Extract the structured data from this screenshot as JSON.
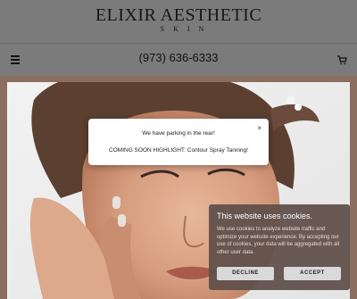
{
  "header": {
    "logo_main": "ELIXIR AESTHETIC",
    "logo_sub": "SKIN"
  },
  "navbar": {
    "phone": "(973) 636-6333"
  },
  "modal": {
    "close": "×",
    "line1": "We have parking in the rear!",
    "line2": "COMING SOON HIGHLIGHT: Contour Spray Tanning!"
  },
  "cookie": {
    "title": "This website uses cookies.",
    "text": "We use cookies to analyze website traffic and optimize your website experience. By accepting our use of cookies, your data will be aggregated with all other user data.",
    "decline": "DECLINE",
    "accept": "ACCEPT"
  },
  "colors": {
    "header_bg": "#7b7b7b",
    "page_bg": "#8a6e60",
    "cookie_bg": "#60504a"
  },
  "icons": [
    "menu-icon",
    "cart-icon",
    "close-icon"
  ]
}
